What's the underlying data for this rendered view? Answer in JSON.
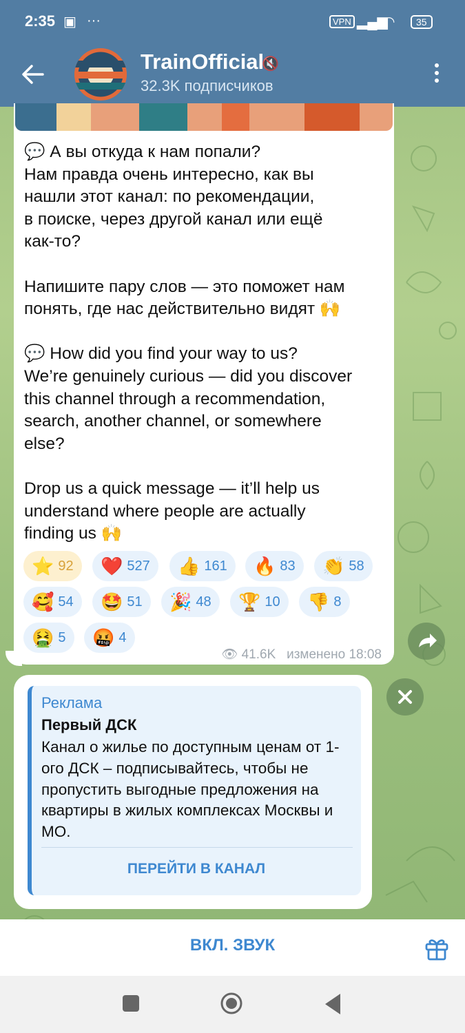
{
  "status_bar": {
    "time": "2:35",
    "vpn": "VPN",
    "battery": "35"
  },
  "header": {
    "channel_name": "TrainOfficial",
    "subscribers": "32.3K подписчиков",
    "back_icon": "arrow-left-icon",
    "menu_icon": "more-vertical-icon",
    "muted_icon": "muted-speaker-icon"
  },
  "message": {
    "ru_line1": "💬 А вы откуда к нам попали?",
    "ru_line2": "Нам правда очень интересно, как вы",
    "ru_line3": "нашли этот канал: по рекомендации,",
    "ru_line4": "в поиске, через другой канал или ещё",
    "ru_line5": "как-то?",
    "ru_line6": "Напишите пару слов — это поможет нам",
    "ru_line7": "понять, где нас действительно видят 🙌",
    "en_line1": "💬 How did you find your way to us?",
    "en_line2": "We’re genuinely curious — did you discover",
    "en_line3": "this channel through a recommendation,",
    "en_line4": "search, another channel, or somewhere",
    "en_line5": "else?",
    "en_line6": "Drop us a quick message — it’ll help us",
    "en_line7": "understand where people are actually",
    "en_line8": "finding us 🙌",
    "views": "41.6K",
    "edited": "изменено 18:08"
  },
  "reactions": [
    {
      "emoji": "⭐",
      "count": "92"
    },
    {
      "emoji": "❤️",
      "count": "527"
    },
    {
      "emoji": "👍",
      "count": "161"
    },
    {
      "emoji": "🔥",
      "count": "83"
    },
    {
      "emoji": "👏",
      "count": "58"
    },
    {
      "emoji": "🥰",
      "count": "54"
    },
    {
      "emoji": "🤩",
      "count": "51"
    },
    {
      "emoji": "🎉",
      "count": "48"
    },
    {
      "emoji": "🏆",
      "count": "10"
    },
    {
      "emoji": "👎",
      "count": "8"
    },
    {
      "emoji": "🤮",
      "count": "5"
    },
    {
      "emoji": "🤬",
      "count": "4"
    }
  ],
  "ad": {
    "label": "Реклама",
    "title": "Первый ДСК",
    "text": "Канал о жилье по доступным ценам от 1-ого ДСК – подписывайтесь, чтобы не пропустить выгодные предложения на квартиры в жилых комплексах Москвы и МО.",
    "button": "ПЕРЕЙТИ В КАНАЛ"
  },
  "bottom_bar": {
    "sound_button": "ВКЛ. ЗВУК",
    "gift_icon": "gift-icon"
  },
  "colors": {
    "header_bg": "#527da3",
    "accent": "#3e88d0",
    "chat_bg": "#a3c483"
  }
}
